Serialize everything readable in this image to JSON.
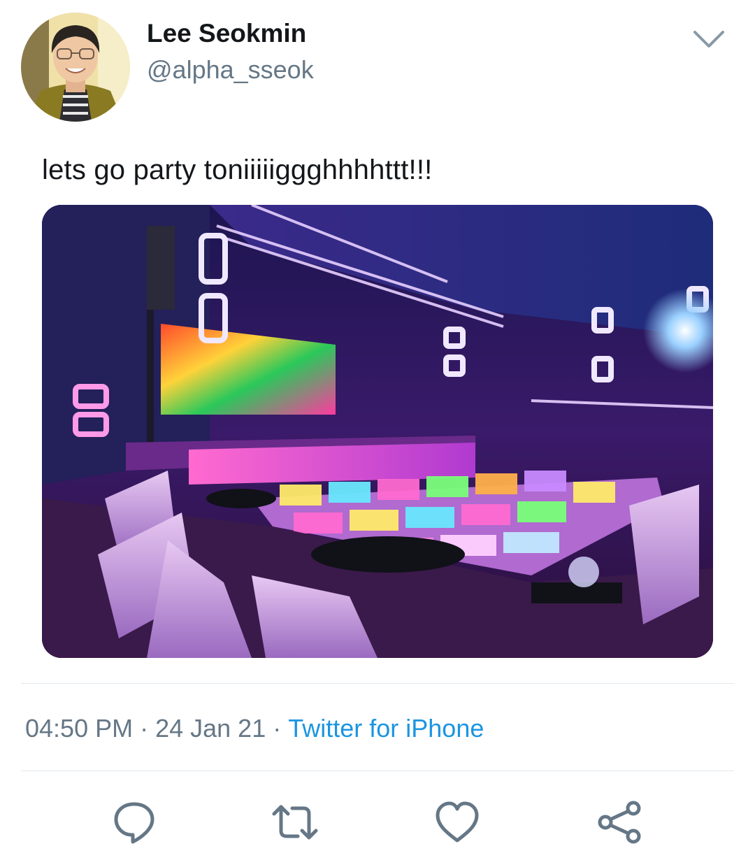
{
  "author": {
    "display_name": "Lee Seokmin",
    "handle": "@alpha_sseok",
    "avatar_icon": "profile-photo"
  },
  "tweet": {
    "text": "lets go party toniiiiiggghhhhttt!!!",
    "media_description": "neon-lit nightclub with light-up dance floor"
  },
  "meta": {
    "time": "04:50 PM",
    "separator": "·",
    "date": "24 Jan 21",
    "source": "Twitter for iPhone"
  },
  "actions": [
    {
      "icon": "reply-icon"
    },
    {
      "icon": "retweet-icon"
    },
    {
      "icon": "like-icon"
    },
    {
      "icon": "share-icon"
    }
  ],
  "colors": {
    "text_primary": "#14171a",
    "text_secondary": "#657786",
    "link": "#1b95e0",
    "icon": "#657786",
    "divider": "#e1e8ed"
  }
}
